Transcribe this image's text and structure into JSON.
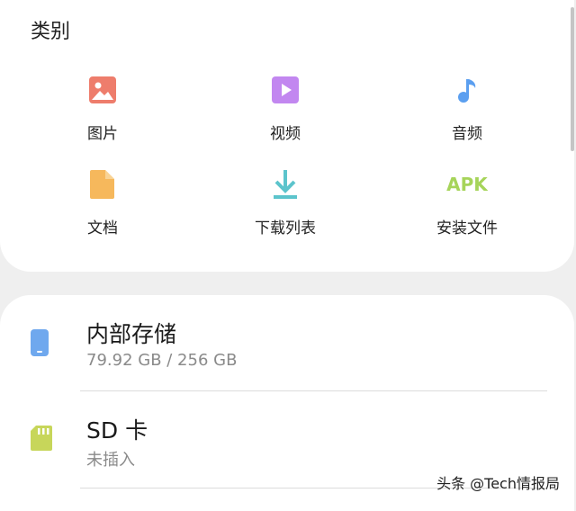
{
  "categories": {
    "title": "类别",
    "items": [
      {
        "label": "图片",
        "icon": "image-icon",
        "color": "#ee7d6c"
      },
      {
        "label": "视频",
        "icon": "video-icon",
        "color": "#c287f0"
      },
      {
        "label": "音频",
        "icon": "music-note-icon",
        "color": "#5b9ff0"
      },
      {
        "label": "文档",
        "icon": "document-icon",
        "color": "#f6b85c"
      },
      {
        "label": "下载列表",
        "icon": "download-icon",
        "color": "#5cc4cc"
      },
      {
        "label": "安装文件",
        "icon": "apk-icon",
        "color": "#a6d45a",
        "icon_text": "APK"
      }
    ]
  },
  "storage": [
    {
      "title": "内部存储",
      "subtitle": "79.92 GB / 256 GB",
      "icon": "phone-icon",
      "color": "#6fa8ee"
    },
    {
      "title": "SD 卡",
      "subtitle": "未插入",
      "icon": "sd-card-icon",
      "color": "#c7d65a"
    }
  ],
  "watermark": "头条 @Tech情报局"
}
